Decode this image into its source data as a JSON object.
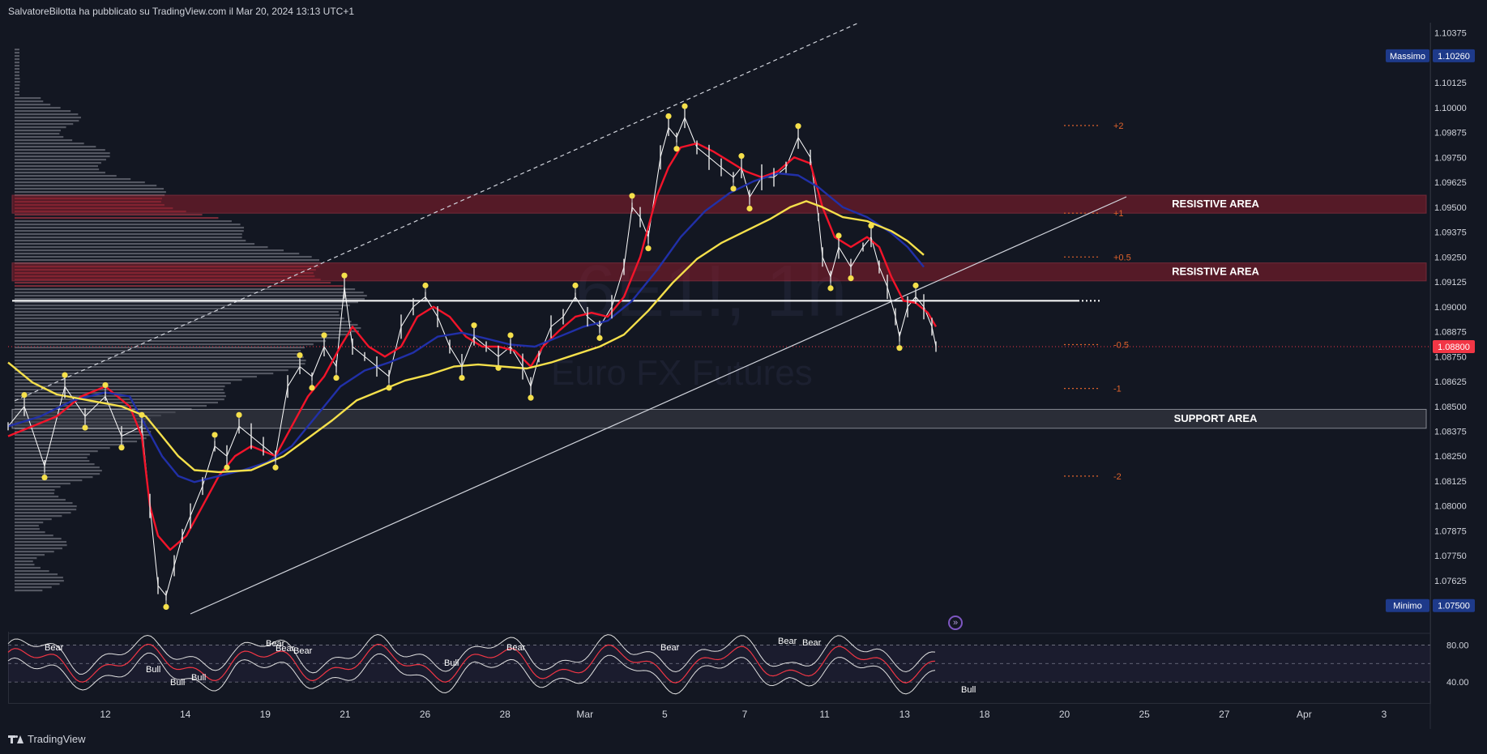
{
  "header": {
    "publish_text": "SalvatoreBilotta ha pubblicato su TradingView.com il Mar 20, 2024 13:13 UTC+1"
  },
  "footer": {
    "brand": "TradingView"
  },
  "watermark": {
    "symbol": "6E1!, 1h",
    "name": "Euro FX Futures"
  },
  "colors": {
    "background": "#131722",
    "price_line": "#ffffff",
    "ema_fast": "#f2142a",
    "ema_mid": "#2130a8",
    "ema_slow": "#f5e04b",
    "pivot_dots": "#f5e04b",
    "resistive_zone": "#8b1e2c",
    "support_zone": "#d1d4dc",
    "fib_levels": "#e0632c",
    "current_price_tag": "#f23645",
    "extreme_tags": "#1e3a8a"
  },
  "chart_data": [
    {
      "type": "line",
      "title": "",
      "description_for_reference_only": "",
      "x": [
        "12",
        "14",
        "19",
        "21",
        "26",
        "28",
        "Mar",
        "5",
        "7",
        "11",
        "13",
        "18",
        "20",
        "25",
        "27",
        "Apr",
        "3"
      ],
      "x_axis_ticks": [
        "12",
        "14",
        "19",
        "21",
        "26",
        "28",
        "Mar",
        "5",
        "7",
        "11",
        "13",
        "18",
        "20",
        "25",
        "27",
        "Apr",
        "3"
      ],
      "y_axis_ticks": [
        "1.10375",
        "1.10250",
        "1.10125",
        "1.10000",
        "1.09875",
        "1.09750",
        "1.09625",
        "1.09500",
        "1.09375",
        "1.09250",
        "1.09125",
        "1.09000",
        "1.08875",
        "1.08750",
        "1.08625",
        "1.08500",
        "1.08375",
        "1.08250",
        "1.08125",
        "1.08000",
        "1.07875",
        "1.07750",
        "1.07625",
        "1.07500"
      ],
      "ylim": [
        1.0745,
        1.1041
      ],
      "grid": false,
      "series": [
        {
          "points": [
            [
              0,
              1.084
            ],
            [
              20,
              1.085
            ],
            [
              45,
              1.082
            ],
            [
              70,
              1.086
            ],
            [
              95,
              1.0845
            ],
            [
              120,
              1.0855
            ],
            [
              140,
              1.0835
            ],
            [
              165,
              1.084
            ],
            [
              175,
              1.08
            ],
            [
              185,
              1.076
            ],
            [
              195,
              1.0755
            ],
            [
              205,
              1.077
            ],
            [
              215,
              1.0785
            ],
            [
              225,
              1.0795
            ],
            [
              240,
              1.081
            ],
            [
              255,
              1.083
            ],
            [
              270,
              1.0825
            ],
            [
              285,
              1.084
            ],
            [
              300,
              1.0835
            ],
            [
              315,
              1.083
            ],
            [
              330,
              1.0825
            ],
            [
              345,
              1.086
            ],
            [
              360,
              1.087
            ],
            [
              375,
              1.0865
            ],
            [
              390,
              1.088
            ],
            [
              405,
              1.087
            ],
            [
              415,
              1.091
            ],
            [
              425,
              1.088
            ],
            [
              440,
              1.0875
            ],
            [
              455,
              1.087
            ],
            [
              470,
              1.0865
            ],
            [
              485,
              1.089
            ],
            [
              500,
              1.09
            ],
            [
              515,
              1.0905
            ],
            [
              530,
              1.0895
            ],
            [
              545,
              1.088
            ],
            [
              560,
              1.087
            ],
            [
              575,
              1.0885
            ],
            [
              590,
              1.088
            ],
            [
              605,
              1.0875
            ],
            [
              620,
              1.088
            ],
            [
              635,
              1.087
            ],
            [
              645,
              1.086
            ],
            [
              655,
              1.0875
            ],
            [
              670,
              1.089
            ],
            [
              685,
              1.0895
            ],
            [
              700,
              1.0905
            ],
            [
              715,
              1.0895
            ],
            [
              730,
              1.089
            ],
            [
              745,
              1.09
            ],
            [
              760,
              1.092
            ],
            [
              770,
              1.095
            ],
            [
              780,
              1.0945
            ],
            [
              790,
              1.0935
            ],
            [
              805,
              1.0975
            ],
            [
              815,
              1.099
            ],
            [
              825,
              1.0985
            ],
            [
              835,
              1.0995
            ],
            [
              850,
              1.098
            ],
            [
              865,
              1.0975
            ],
            [
              880,
              1.097
            ],
            [
              895,
              1.0965
            ],
            [
              905,
              1.097
            ],
            [
              915,
              1.0955
            ],
            [
              930,
              1.0965
            ],
            [
              945,
              1.0965
            ],
            [
              960,
              1.097
            ],
            [
              975,
              1.0985
            ],
            [
              990,
              1.0975
            ],
            [
              1000,
              1.0945
            ],
            [
              1005,
              1.0925
            ],
            [
              1015,
              1.0915
            ],
            [
              1025,
              1.093
            ],
            [
              1040,
              1.092
            ],
            [
              1055,
              1.093
            ],
            [
              1065,
              1.0935
            ],
            [
              1075,
              1.092
            ],
            [
              1085,
              1.091
            ],
            [
              1095,
              1.0895
            ],
            [
              1100,
              1.0885
            ],
            [
              1110,
              1.09
            ],
            [
              1120,
              1.0905
            ],
            [
              1130,
              1.09
            ],
            [
              1140,
              1.089
            ],
            [
              1145,
              1.088
            ]
          ]
        },
        {
          "points": [
            [
              0,
              1.0835
            ],
            [
              30,
              1.084
            ],
            [
              60,
              1.0845
            ],
            [
              90,
              1.0855
            ],
            [
              120,
              1.086
            ],
            [
              150,
              1.085
            ],
            [
              165,
              1.0835
            ],
            [
              175,
              1.08
            ],
            [
              185,
              1.0785
            ],
            [
              200,
              1.0778
            ],
            [
              220,
              1.0785
            ],
            [
              240,
              1.08
            ],
            [
              260,
              1.0815
            ],
            [
              280,
              1.0825
            ],
            [
              300,
              1.083
            ],
            [
              330,
              1.0825
            ],
            [
              350,
              1.084
            ],
            [
              370,
              1.0855
            ],
            [
              390,
              1.0865
            ],
            [
              410,
              1.088
            ],
            [
              425,
              1.089
            ],
            [
              445,
              1.088
            ],
            [
              465,
              1.0875
            ],
            [
              485,
              1.088
            ],
            [
              505,
              1.0895
            ],
            [
              525,
              1.09
            ],
            [
              545,
              1.0895
            ],
            [
              565,
              1.0885
            ],
            [
              585,
              1.088
            ],
            [
              605,
              1.088
            ],
            [
              625,
              1.0878
            ],
            [
              645,
              1.087
            ],
            [
              660,
              1.088
            ],
            [
              680,
              1.0888
            ],
            [
              700,
              1.0895
            ],
            [
              720,
              1.0897
            ],
            [
              740,
              1.0895
            ],
            [
              760,
              1.0905
            ],
            [
              780,
              1.0925
            ],
            [
              800,
              1.0955
            ],
            [
              815,
              1.097
            ],
            [
              830,
              1.098
            ],
            [
              850,
              1.0982
            ],
            [
              870,
              1.0978
            ],
            [
              890,
              1.0973
            ],
            [
              910,
              1.0968
            ],
            [
              930,
              1.0965
            ],
            [
              950,
              1.0968
            ],
            [
              970,
              1.0975
            ],
            [
              990,
              1.0972
            ],
            [
              1005,
              1.095
            ],
            [
              1020,
              1.0935
            ],
            [
              1040,
              1.093
            ],
            [
              1060,
              1.0935
            ],
            [
              1075,
              1.093
            ],
            [
              1090,
              1.0915
            ],
            [
              1105,
              1.0903
            ],
            [
              1120,
              1.0902
            ],
            [
              1135,
              1.0897
            ],
            [
              1145,
              1.089
            ]
          ]
        },
        {
          "points": [
            [
              0,
              1.084
            ],
            [
              40,
              1.0845
            ],
            [
              80,
              1.0853
            ],
            [
              120,
              1.0857
            ],
            [
              150,
              1.0855
            ],
            [
              170,
              1.084
            ],
            [
              190,
              1.0825
            ],
            [
              210,
              1.0815
            ],
            [
              230,
              1.0812
            ],
            [
              260,
              1.0815
            ],
            [
              290,
              1.0818
            ],
            [
              320,
              1.0822
            ],
            [
              350,
              1.083
            ],
            [
              380,
              1.0845
            ],
            [
              410,
              1.086
            ],
            [
              440,
              1.0868
            ],
            [
              470,
              1.0872
            ],
            [
              500,
              1.0877
            ],
            [
              530,
              1.0885
            ],
            [
              560,
              1.0887
            ],
            [
              590,
              1.0884
            ],
            [
              620,
              1.0881
            ],
            [
              650,
              1.088
            ],
            [
              680,
              1.0885
            ],
            [
              710,
              1.089
            ],
            [
              740,
              1.0893
            ],
            [
              770,
              1.0903
            ],
            [
              800,
              1.0918
            ],
            [
              830,
              1.0935
            ],
            [
              860,
              1.0948
            ],
            [
              890,
              1.0957
            ],
            [
              920,
              1.0963
            ],
            [
              950,
              1.0967
            ],
            [
              975,
              1.0966
            ],
            [
              1000,
              1.096
            ],
            [
              1030,
              1.095
            ],
            [
              1060,
              1.0945
            ],
            [
              1090,
              1.0937
            ],
            [
              1110,
              1.093
            ],
            [
              1130,
              1.092
            ]
          ]
        },
        {
          "points": [
            [
              0,
              1.0872
            ],
            [
              30,
              1.0862
            ],
            [
              60,
              1.0856
            ],
            [
              100,
              1.0853
            ],
            [
              140,
              1.085
            ],
            [
              170,
              1.0845
            ],
            [
              190,
              1.0835
            ],
            [
              210,
              1.0825
            ],
            [
              230,
              1.0818
            ],
            [
              260,
              1.0817
            ],
            [
              300,
              1.0818
            ],
            [
              340,
              1.0825
            ],
            [
              370,
              1.0834
            ],
            [
              400,
              1.0843
            ],
            [
              430,
              1.0853
            ],
            [
              460,
              1.0858
            ],
            [
              490,
              1.0863
            ],
            [
              520,
              1.0866
            ],
            [
              550,
              1.087
            ],
            [
              580,
              1.0871
            ],
            [
              610,
              1.087
            ],
            [
              640,
              1.0869
            ],
            [
              670,
              1.0872
            ],
            [
              700,
              1.0876
            ],
            [
              730,
              1.088
            ],
            [
              760,
              1.0886
            ],
            [
              790,
              1.0898
            ],
            [
              820,
              1.0912
            ],
            [
              850,
              1.0924
            ],
            [
              880,
              1.0932
            ],
            [
              910,
              1.0938
            ],
            [
              940,
              1.0944
            ],
            [
              965,
              1.095
            ],
            [
              985,
              1.0953
            ],
            [
              1005,
              1.095
            ],
            [
              1030,
              1.0945
            ],
            [
              1060,
              1.0943
            ],
            [
              1090,
              1.0938
            ],
            [
              1110,
              1.0933
            ],
            [
              1130,
              1.0926
            ]
          ]
        }
      ]
    },
    {
      "type": "line",
      "title": "",
      "y_axis_ticks": [
        "80.00",
        "40.00"
      ],
      "ylim": [
        20,
        90
      ],
      "annotations": [
        "Bear",
        "Bull",
        "Bull",
        "Bull",
        "Bear",
        "Bear",
        "Bear",
        "Bull",
        "Bear",
        "Bear",
        "Bear",
        "Bear",
        "Bull"
      ]
    }
  ],
  "zones": [
    {
      "label": "RESISTIVE AREA",
      "top": 1.0956,
      "bottom": 1.0947,
      "kind": "resistive"
    },
    {
      "label": "RESISTIVE AREA",
      "top": 1.0922,
      "bottom": 1.0913,
      "kind": "resistive"
    },
    {
      "label": "SUPPORT AREA",
      "top": 1.08485,
      "bottom": 1.0839,
      "kind": "support"
    }
  ],
  "key_level": 1.0903,
  "fib_levels": [
    {
      "label": "+2",
      "value": 1.0991
    },
    {
      "label": "+1",
      "value": 1.0947
    },
    {
      "label": "+0.5",
      "value": 1.0925
    },
    {
      "label": "-0.5",
      "value": 1.0881
    },
    {
      "label": "-1",
      "value": 1.0859
    },
    {
      "label": "-2",
      "value": 1.0815
    }
  ],
  "price_tags": {
    "high_label": "Massimo",
    "high_value": "1.10260",
    "last_value": "1.08800",
    "low_label": "Minimo",
    "low_value": "1.07500"
  }
}
